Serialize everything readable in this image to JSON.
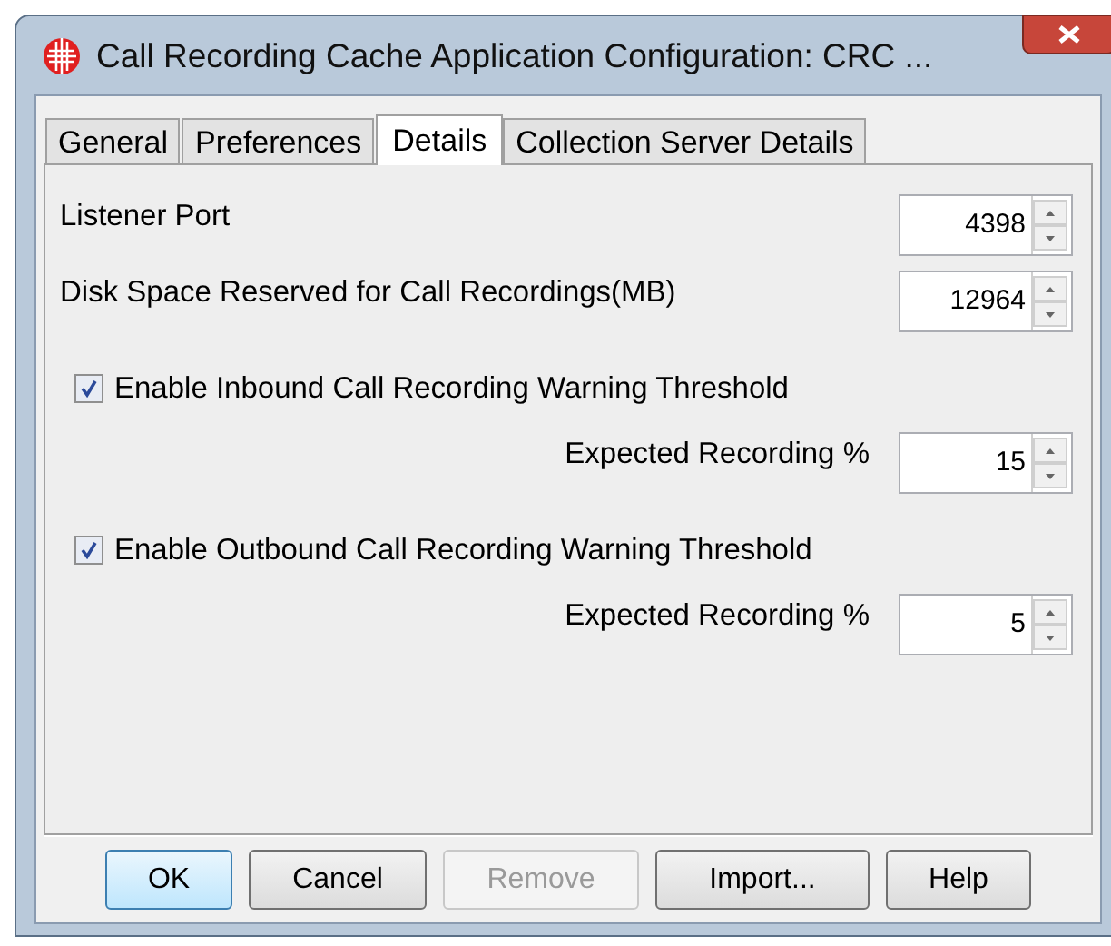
{
  "window": {
    "title": "Call Recording Cache Application Configuration: CRC ..."
  },
  "tabs": [
    {
      "label": "General",
      "selected": false
    },
    {
      "label": "Preferences",
      "selected": false
    },
    {
      "label": "Details",
      "selected": true
    },
    {
      "label": "Collection Server Details",
      "selected": false
    }
  ],
  "rows": [
    {
      "kind": "spinner",
      "label": "Listener Port",
      "value": "4398",
      "indented": false
    },
    {
      "kind": "spinner",
      "label": "Disk Space Reserved for Call Recordings(MB)",
      "value": "12964",
      "indented": false
    },
    {
      "kind": "checkbox",
      "label": "Enable Inbound Call Recording Warning Threshold",
      "checked": true
    },
    {
      "kind": "spinner",
      "label": "Expected Recording %",
      "value": "15",
      "indented": true
    },
    {
      "kind": "checkbox",
      "label": "Enable Outbound Call Recording Warning Threshold",
      "checked": true
    },
    {
      "kind": "spinner",
      "label": "Expected Recording %",
      "value": "5",
      "indented": true
    }
  ],
  "buttons": [
    {
      "label": "OK",
      "disabled": false,
      "default": true
    },
    {
      "label": "Cancel",
      "disabled": false,
      "default": false
    },
    {
      "label": "Remove",
      "disabled": true,
      "default": false
    },
    {
      "label": "Import...",
      "disabled": false,
      "default": false
    },
    {
      "label": "Help",
      "disabled": false,
      "default": false
    }
  ]
}
